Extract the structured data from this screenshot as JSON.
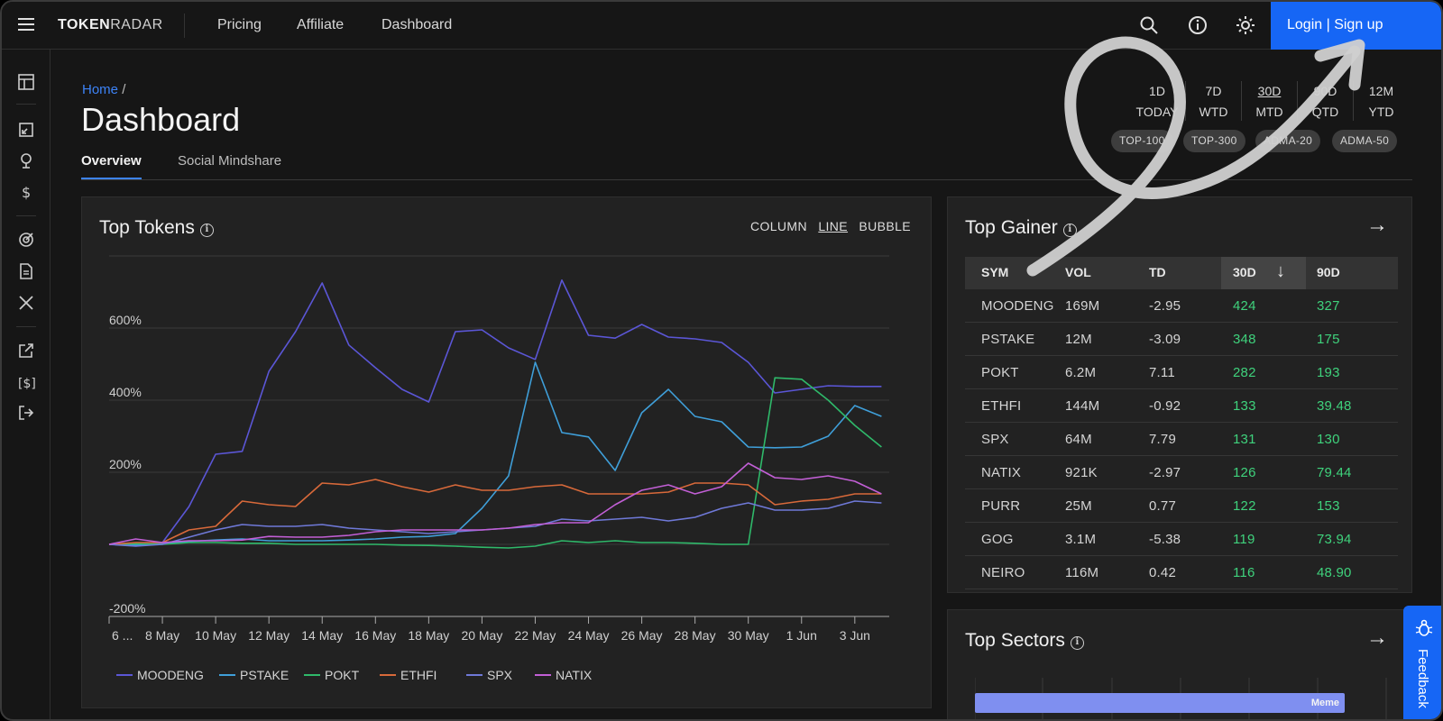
{
  "brand": {
    "bold": "TOKEN",
    "light": "RADAR"
  },
  "nav": {
    "pricing": "Pricing",
    "affiliate": "Affiliate",
    "dashboard": "Dashboard"
  },
  "login": "Login | Sign up",
  "breadcrumb": {
    "home": "Home",
    "sep": "/"
  },
  "page_title": "Dashboard",
  "tabs": [
    "Overview",
    "Social Mindshare"
  ],
  "periods": [
    {
      "top": "1D",
      "bottom": "TODAY",
      "selected": false
    },
    {
      "top": "7D",
      "bottom": "WTD",
      "selected": false
    },
    {
      "top": "30D",
      "bottom": "MTD",
      "selected": true
    },
    {
      "top": "90D",
      "bottom": "QTD",
      "selected": false
    },
    {
      "top": "12M",
      "bottom": "YTD",
      "selected": false
    }
  ],
  "chips": [
    "TOP-100",
    "TOP-300",
    "ADMA-20",
    "ADMA-50"
  ],
  "top_tokens": {
    "title": "Top Tokens",
    "modes": [
      "COLUMN",
      "LINE",
      "BUBBLE"
    ],
    "active_mode": "LINE"
  },
  "chart_data": {
    "type": "line",
    "title": "Top Tokens",
    "x": [
      "6 May",
      "7 May",
      "8 May",
      "9 May",
      "10 May",
      "11 May",
      "12 May",
      "13 May",
      "14 May",
      "15 May",
      "16 May",
      "17 May",
      "18 May",
      "19 May",
      "20 May",
      "21 May",
      "22 May",
      "23 May",
      "24 May",
      "25 May",
      "26 May",
      "27 May",
      "28 May",
      "29 May",
      "30 May",
      "31 May",
      "1 Jun",
      "2 Jun",
      "3 Jun",
      "4 Jun"
    ],
    "x_tick_labels": [
      "6 ...",
      "8 May",
      "10 May",
      "12 May",
      "14 May",
      "16 May",
      "18 May",
      "20 May",
      "22 May",
      "24 May",
      "26 May",
      "28 May",
      "30 May",
      "1 Jun",
      "3 Jun"
    ],
    "y_tick_labels": [
      "-200%",
      "200%",
      "400%",
      "600%"
    ],
    "ylim": [
      -200,
      800
    ],
    "grid": true,
    "legend": "bottom",
    "series": [
      {
        "name": "MOODENG",
        "color": "#5b56d6",
        "values": [
          0,
          0,
          5,
          105,
          250,
          258,
          480,
          590,
          725,
          553,
          490,
          430,
          395,
          590,
          595,
          545,
          513,
          733,
          580,
          572,
          610,
          575,
          570,
          560,
          505,
          420,
          430,
          440,
          438,
          438
        ]
      },
      {
        "name": "PSTAKE",
        "color": "#3f9fd9",
        "values": [
          0,
          -2,
          2,
          8,
          12,
          15,
          10,
          10,
          10,
          12,
          15,
          20,
          22,
          30,
          100,
          190,
          505,
          310,
          298,
          205,
          365,
          430,
          355,
          340,
          270,
          268,
          270,
          300,
          385,
          355
        ]
      },
      {
        "name": "POKT",
        "color": "#2fb96a",
        "values": [
          0,
          2,
          0,
          5,
          5,
          3,
          3,
          0,
          0,
          0,
          0,
          -2,
          -3,
          -5,
          -8,
          -10,
          -5,
          10,
          5,
          10,
          5,
          5,
          3,
          0,
          0,
          462,
          458,
          400,
          330,
          270
        ]
      },
      {
        "name": "ETHFI",
        "color": "#d8693a",
        "values": [
          0,
          5,
          5,
          40,
          50,
          120,
          110,
          105,
          170,
          165,
          180,
          160,
          145,
          165,
          150,
          150,
          160,
          165,
          140,
          140,
          140,
          145,
          170,
          170,
          165,
          110,
          120,
          125,
          140,
          140
        ]
      },
      {
        "name": "SPX",
        "color": "#6f79d8",
        "values": [
          0,
          -5,
          0,
          20,
          40,
          55,
          50,
          50,
          55,
          45,
          40,
          35,
          30,
          35,
          40,
          45,
          50,
          70,
          65,
          70,
          75,
          65,
          75,
          100,
          115,
          95,
          95,
          100,
          120,
          115
        ]
      },
      {
        "name": "NATIX",
        "color": "#c25fd6",
        "values": [
          0,
          15,
          5,
          10,
          10,
          12,
          22,
          20,
          20,
          25,
          35,
          40,
          40,
          40,
          40,
          45,
          55,
          60,
          60,
          110,
          150,
          165,
          140,
          160,
          225,
          185,
          180,
          190,
          175,
          140
        ]
      }
    ]
  },
  "top_gainer": {
    "title": "Top Gainer",
    "columns": [
      "SYM",
      "VOL",
      "TD",
      "30D",
      "90D"
    ],
    "rows": [
      [
        "MOODENG",
        "169M",
        "-2.95",
        "424",
        "327"
      ],
      [
        "PSTAKE",
        "12M",
        "-3.09",
        "348",
        "175"
      ],
      [
        "POKT",
        "6.2M",
        "7.11",
        "282",
        "193"
      ],
      [
        "ETHFI",
        "144M",
        "-0.92",
        "133",
        "39.48"
      ],
      [
        "SPX",
        "64M",
        "7.79",
        "131",
        "130"
      ],
      [
        "NATIX",
        "921K",
        "-2.97",
        "126",
        "79.44"
      ],
      [
        "PURR",
        "25M",
        "0.77",
        "122",
        "153"
      ],
      [
        "GOG",
        "3.1M",
        "-5.38",
        "119",
        "73.94"
      ],
      [
        "NEIRO",
        "116M",
        "0.42",
        "116",
        "48.90"
      ]
    ]
  },
  "top_sectors": {
    "title": "Top Sectors",
    "first_sector": "Meme"
  },
  "feedback": "Feedback"
}
